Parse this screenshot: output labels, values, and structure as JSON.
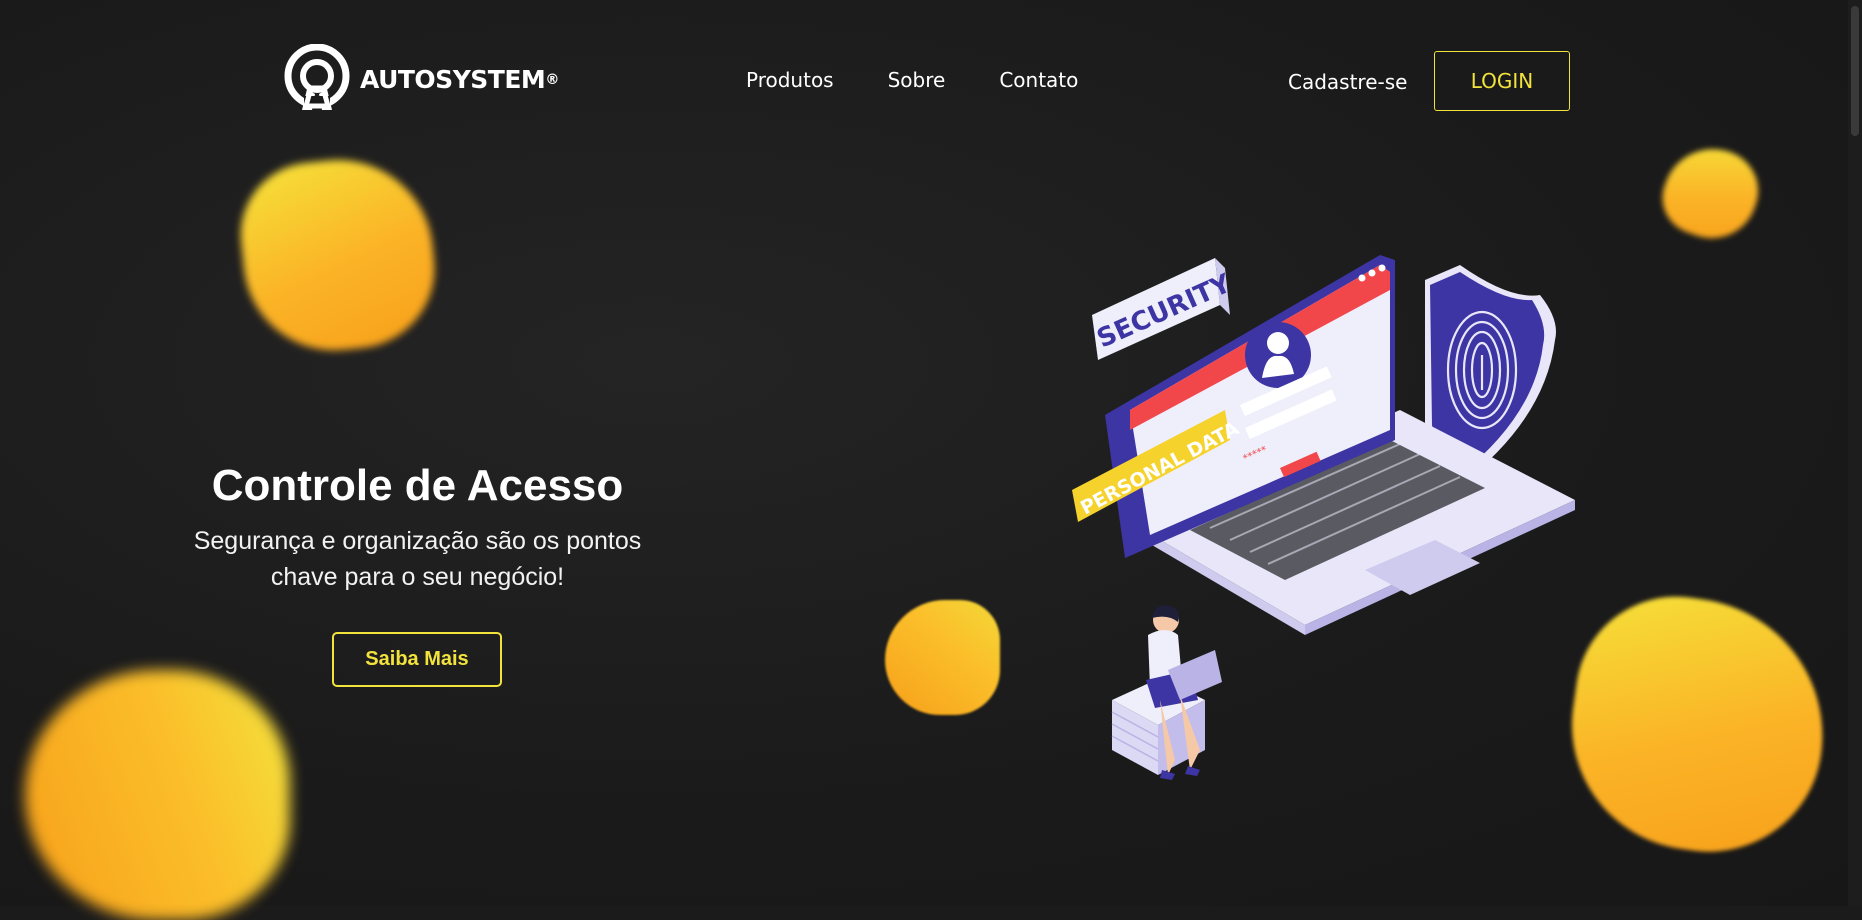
{
  "brand": {
    "name": "AUTOSYSTEM",
    "registered_mark": "®"
  },
  "nav": {
    "items": [
      "Produtos",
      "Sobre",
      "Contato"
    ]
  },
  "auth": {
    "signup_label": "Cadastre-se",
    "login_label": "LOGIN"
  },
  "hero": {
    "title": "Controle de Acesso",
    "subtitle_line1": "Segurança e organização são os pontos",
    "subtitle_line2": "chave para o seu negócio!",
    "cta_label": "Saiba Mais"
  },
  "illustration": {
    "security_tag": "SECURITY",
    "personal_data_tag": "PERSONAL DATA",
    "password_mask": "*****"
  },
  "colors": {
    "background": "#1b1b1b",
    "accent": "#f2e23c",
    "blob_yellow": "#f5e23a",
    "blob_orange": "#f7a01a",
    "illustration_purple": "#3d35a3",
    "illustration_red": "#f2474a"
  },
  "icons": [
    "autosystem-logo-icon",
    "fingerprint-icon",
    "user-avatar-icon"
  ]
}
